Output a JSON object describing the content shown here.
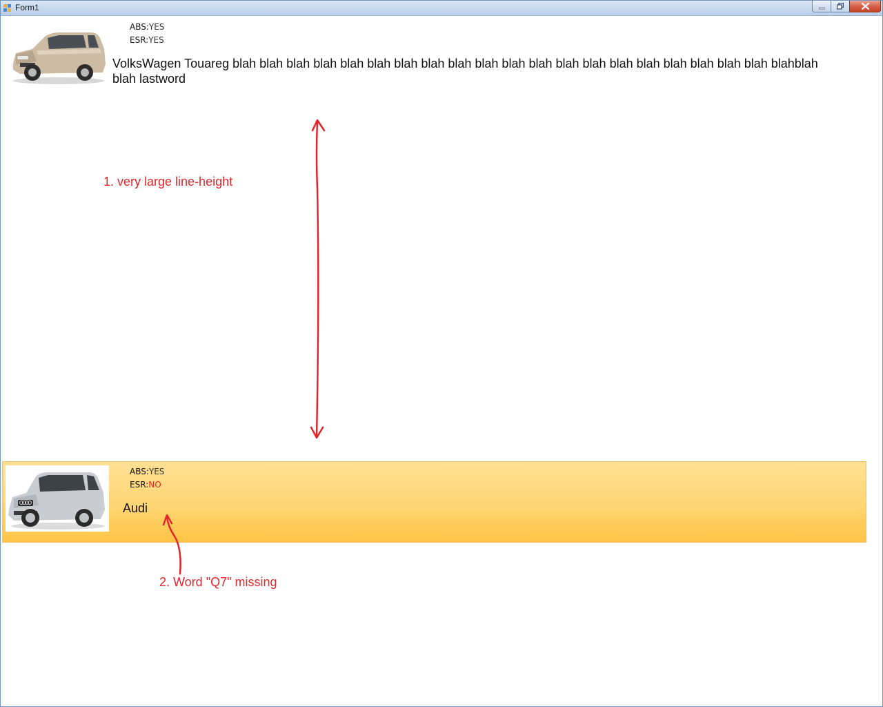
{
  "window": {
    "title": "Form1"
  },
  "items": [
    {
      "abs_label": "ABS:",
      "abs_value": "YES",
      "esr_label": "ESR:",
      "esr_value": "YES",
      "description": "VolksWagen Touareg blah blah blah blah blah blah blah blah blah blah blah blah blah blah blah blah blah blah blah blah blahblah blah lastword",
      "image_icon": "beige-suv-photo",
      "selected": false
    },
    {
      "abs_label": "ABS:",
      "abs_value": "YES",
      "esr_label": "ESR:",
      "esr_value": "NO",
      "description": "Audi",
      "image_icon": "silver-suv-photo",
      "selected": true
    }
  ],
  "annotations": [
    {
      "text": "1. very large line-height"
    },
    {
      "text": "2. Word \"Q7\" missing"
    }
  ],
  "colors": {
    "selection_top": "#ffe094",
    "selection_bottom": "#ffc445",
    "annotation": "#e0262a",
    "esr_no": "#e5261e"
  }
}
